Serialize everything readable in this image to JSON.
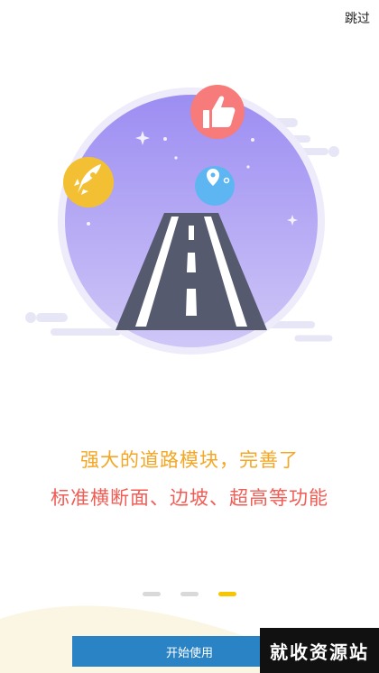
{
  "header": {
    "skip_label": "跳过"
  },
  "content": {
    "line1": "强大的道路模块，完善了",
    "line2": "标准横断面、边坡、超高等功能"
  },
  "pager": {
    "count": 3,
    "active_index": 2
  },
  "button": {
    "start_label": "开始使用"
  },
  "watermark": {
    "text": "就收资源站"
  },
  "colors": {
    "accent_orange": "#f5a623",
    "accent_red": "#f25c54",
    "active_dot": "#f7c600",
    "button_blue": "#2a83c5"
  }
}
